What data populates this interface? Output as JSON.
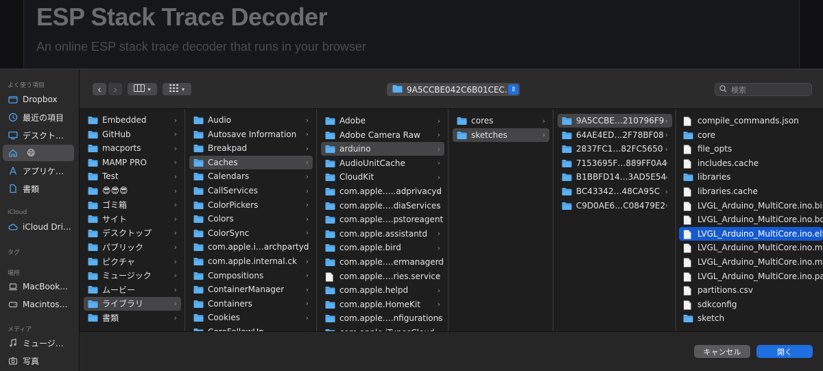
{
  "webpage": {
    "title": "ESP Stack Trace Decoder",
    "subtitle": "An online ESP stack trace decoder that runs in your browser"
  },
  "sidebar": {
    "sections": [
      {
        "label": "よく使う項目"
      },
      {
        "label": "iCloud"
      },
      {
        "label": "タグ"
      },
      {
        "label": "場所"
      },
      {
        "label": "メディア"
      }
    ],
    "favorites": [
      {
        "label": "Dropbox",
        "icon": "dropbox-folder-icon"
      },
      {
        "label": "最近の項目",
        "icon": "clock-icon"
      },
      {
        "label": "デスクト…",
        "icon": "desktop-icon"
      },
      {
        "label": "😄",
        "icon": "home-icon",
        "selected": true
      },
      {
        "label": "アプリケ…",
        "icon": "applications-icon"
      },
      {
        "label": "書類",
        "icon": "document-icon"
      }
    ],
    "icloud": [
      {
        "label": "iCloud Dri…",
        "icon": "cloud-icon"
      }
    ],
    "locations": [
      {
        "label": "MacBook…",
        "icon": "laptop-icon"
      },
      {
        "label": "Macintos…",
        "icon": "disk-icon"
      }
    ],
    "media": [
      {
        "label": "ミュージ…",
        "icon": "music-note-icon"
      },
      {
        "label": "写真",
        "icon": "camera-icon"
      }
    ]
  },
  "toolbar": {
    "back": "‹",
    "forward": "›",
    "view_icon": "column-view-icon",
    "group_icon": "grid-group-icon",
    "path": "9A5CCBE042C6B01CEC…",
    "search_placeholder": "検索"
  },
  "columns": [
    {
      "items": [
        {
          "label": "Embedded",
          "arrow": true
        },
        {
          "label": "GitHub",
          "arrow": true
        },
        {
          "label": "macports",
          "arrow": true
        },
        {
          "label": "MAMP PRO",
          "arrow": true
        },
        {
          "label": "Test",
          "arrow": true
        },
        {
          "label": "😎😎😎",
          "arrow": true
        },
        {
          "label": "ゴミ箱",
          "arrow": true
        },
        {
          "label": "サイト",
          "arrow": true
        },
        {
          "label": "デスクトップ",
          "arrow": true
        },
        {
          "label": "パブリック",
          "arrow": true
        },
        {
          "label": "ピクチャ",
          "arrow": true
        },
        {
          "label": "ミュージック",
          "arrow": true
        },
        {
          "label": "ムービー",
          "arrow": true
        },
        {
          "label": "ライブラリ",
          "arrow": true,
          "selected": "gray"
        },
        {
          "label": "書類",
          "arrow": true
        }
      ]
    },
    {
      "items": [
        {
          "label": "Audio",
          "arrow": true
        },
        {
          "label": "Autosave Information",
          "arrow": true
        },
        {
          "label": "Breakpad",
          "arrow": true
        },
        {
          "label": "Caches",
          "arrow": true,
          "selected": "gray"
        },
        {
          "label": "Calendars",
          "arrow": true
        },
        {
          "label": "CallServices",
          "arrow": true
        },
        {
          "label": "ColorPickers",
          "arrow": true
        },
        {
          "label": "Colors",
          "arrow": true
        },
        {
          "label": "ColorSync",
          "arrow": true
        },
        {
          "label": "com.apple.i…archpartyd",
          "arrow": true
        },
        {
          "label": "com.apple.internal.ck",
          "arrow": true
        },
        {
          "label": "Compositions",
          "arrow": true
        },
        {
          "label": "ContainerManager",
          "arrow": true
        },
        {
          "label": "Containers",
          "arrow": true
        },
        {
          "label": "Cookies",
          "arrow": true
        },
        {
          "label": "CoreFollowUp",
          "arrow": true
        }
      ]
    },
    {
      "items": [
        {
          "label": "Adobe",
          "arrow": true
        },
        {
          "label": "Adobe Camera Raw",
          "arrow": true
        },
        {
          "label": "arduino",
          "arrow": true,
          "selected": "gray"
        },
        {
          "label": "AudioUnitCache",
          "arrow": true
        },
        {
          "label": "CloudKit",
          "arrow": true
        },
        {
          "label": "com.apple.….adprivacyd",
          "arrow": true
        },
        {
          "label": "com.apple.…diaServices",
          "arrow": true
        },
        {
          "label": "com.apple.…pstoreagent",
          "arrow": true
        },
        {
          "label": "com.apple.assistantd",
          "arrow": true
        },
        {
          "label": "com.apple.bird",
          "arrow": true
        },
        {
          "label": "com.apple.…ermanagerd",
          "arrow": true
        },
        {
          "label": "com.apple.…ries.service",
          "arrow": true,
          "file": true
        },
        {
          "label": "com.apple.helpd",
          "arrow": true
        },
        {
          "label": "com.apple.HomeKit",
          "arrow": true
        },
        {
          "label": "com.apple.…nfigurations",
          "arrow": true
        },
        {
          "label": "com.apple.iTunesCloud",
          "arrow": true
        }
      ]
    },
    {
      "items": [
        {
          "label": "cores",
          "arrow": true
        },
        {
          "label": "sketches",
          "arrow": true,
          "selected": "gray"
        }
      ]
    },
    {
      "items": [
        {
          "label": "9A5CCBE…210796F9",
          "arrow": true,
          "selected": "gray"
        },
        {
          "label": "64AE4ED…2F78BF08",
          "arrow": true
        },
        {
          "label": "2837FC1…82FC5650",
          "arrow": true
        },
        {
          "label": "7153695F…889FF0A4",
          "arrow": true
        },
        {
          "label": "B1BBFD14…3AD5E54",
          "arrow": true
        },
        {
          "label": "BC43342…48CA95C",
          "arrow": true
        },
        {
          "label": "C9D0AE6…C08479E2",
          "arrow": true
        }
      ]
    },
    {
      "items": [
        {
          "label": "compile_commands.json",
          "file": true
        },
        {
          "label": "core",
          "arrow": false
        },
        {
          "label": "file_opts",
          "file": true
        },
        {
          "label": "includes.cache",
          "file": true
        },
        {
          "label": "libraries",
          "arrow": false
        },
        {
          "label": "libraries.cache",
          "file": true
        },
        {
          "label": "LVGL_Arduino_MultiCore.ino.bin",
          "file": true
        },
        {
          "label": "LVGL_Arduino_MultiCore.ino.bootloader.bin",
          "file": true
        },
        {
          "label": "LVGL_Arduino_MultiCore.ino.elf",
          "file": true,
          "selected": "blue"
        },
        {
          "label": "LVGL_Arduino_MultiCore.ino.map",
          "file": true
        },
        {
          "label": "LVGL_Arduino_MultiCore.ino.merged.bin",
          "file": true
        },
        {
          "label": "LVGL_Arduino_MultiCore.ino.partitions.bin",
          "file": true
        },
        {
          "label": "partitions.csv",
          "file": true
        },
        {
          "label": "sdkconfig",
          "file": true
        },
        {
          "label": "sketch",
          "arrow": false
        }
      ]
    }
  ],
  "bottombar": {
    "cancel": "キャンセル",
    "open": "開く"
  },
  "colors": {
    "accent": "#1f6fe0",
    "selection_blue": "#1559cf",
    "folder": "#5ab0f0",
    "sidebar_bg": "#2a2a2b"
  }
}
